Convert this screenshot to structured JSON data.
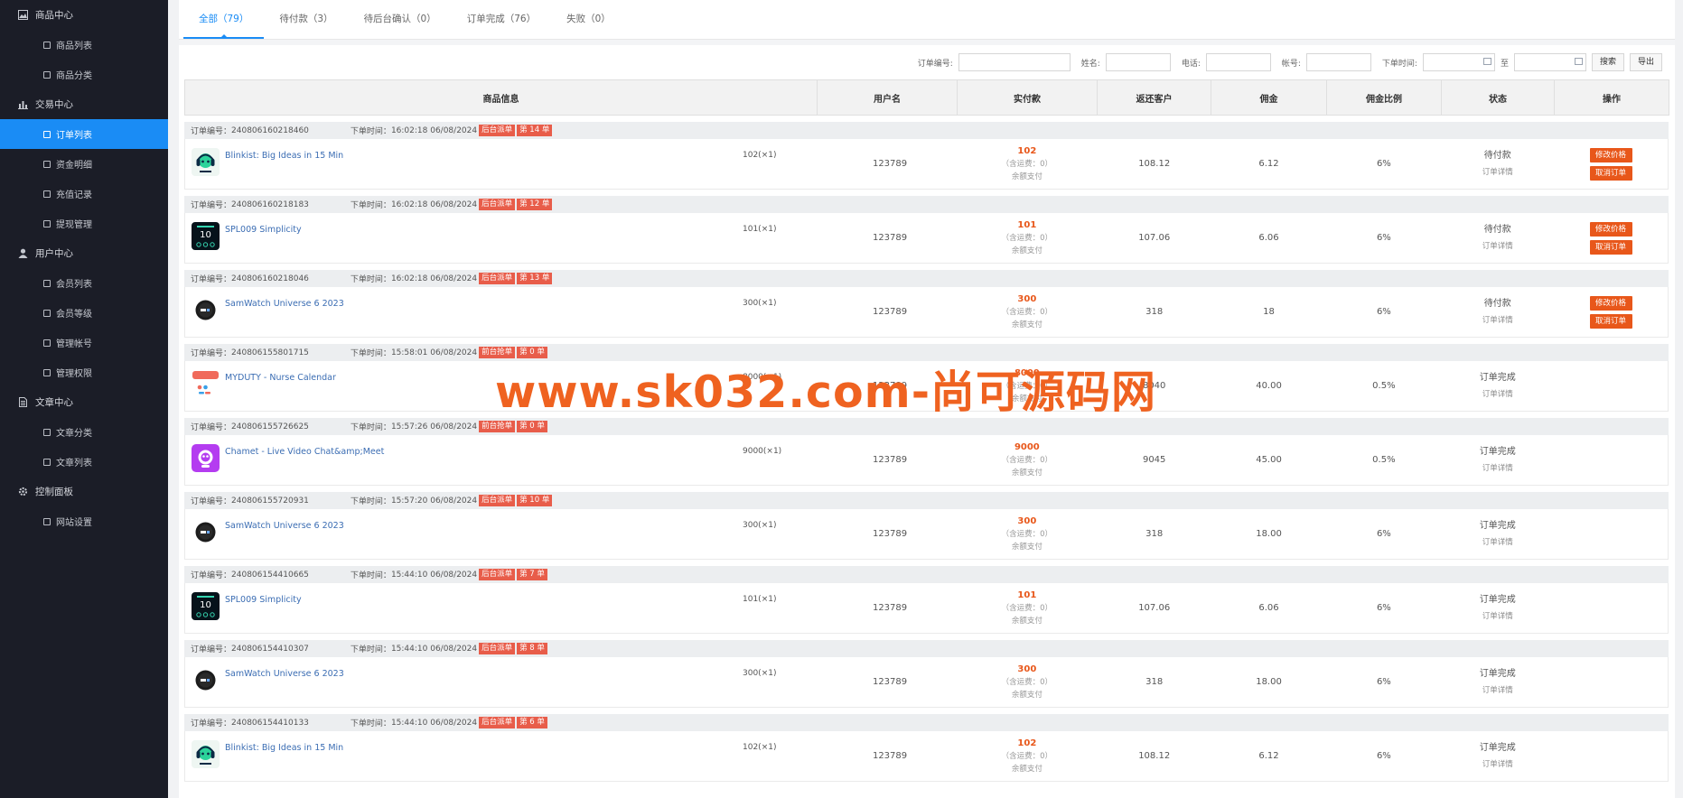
{
  "sidebar": {
    "groups": [
      {
        "label": "商品中心",
        "icon": "image-icon",
        "items": [
          {
            "label": "商品列表"
          },
          {
            "label": "商品分类"
          }
        ]
      },
      {
        "label": "交易中心",
        "icon": "chart-icon",
        "items": [
          {
            "label": "订单列表",
            "active": true
          },
          {
            "label": "资金明细"
          },
          {
            "label": "充值记录"
          },
          {
            "label": "提现管理"
          }
        ]
      },
      {
        "label": "用户中心",
        "icon": "user-icon",
        "items": [
          {
            "label": "会员列表"
          },
          {
            "label": "会员等级"
          },
          {
            "label": "管理帐号"
          },
          {
            "label": "管理权限"
          }
        ]
      },
      {
        "label": "文章中心",
        "icon": "document-icon",
        "items": [
          {
            "label": "文章分类"
          },
          {
            "label": "文章列表"
          }
        ]
      },
      {
        "label": "控制面板",
        "icon": "gear-icon",
        "items": [
          {
            "label": "网站设置"
          }
        ]
      }
    ]
  },
  "tabs": [
    {
      "label": "全部（79）",
      "active": true
    },
    {
      "label": "待付款（3）"
    },
    {
      "label": "待后台确认（0）"
    },
    {
      "label": "订单完成（76）"
    },
    {
      "label": "失败（0）"
    }
  ],
  "filter": {
    "order_no_label": "订单编号:",
    "name_label": "姓名:",
    "phone_label": "电话:",
    "account_label": "帐号:",
    "time_label": "下单时间:",
    "to_label": "至",
    "search_button": "搜索",
    "export_button": "导出"
  },
  "columns": [
    "商品信息",
    "用户名",
    "实付款",
    "返还客户",
    "佣金",
    "佣金比例",
    "状态",
    "操作"
  ],
  "labels": {
    "order_no": "订单编号：",
    "order_time": "下单时间：",
    "discount": "（含运费：0）",
    "pay_method": "余额支付",
    "order_detail": "订单详情",
    "edit_price": "修改价格",
    "cancel_order": "取消订单"
  },
  "orders": [
    {
      "no": "240806160218460",
      "time": "16:02:18 06/08/2024",
      "tag1": "后台派单",
      "tag2": "第 14 单",
      "product": "Blinkist: Big Ideas in 15 Min",
      "thumb": "blinkist",
      "qty": "102(×1)",
      "user": "123789",
      "paid": "102",
      "back": "108.12",
      "comm": "6.12",
      "rate": "6%",
      "status": "待付款",
      "pending": true
    },
    {
      "no": "240806160218183",
      "time": "16:02:18 06/08/2024",
      "tag1": "后台派单",
      "tag2": "第 12 单",
      "product": "SPL009 Simplicity",
      "thumb": "watch10",
      "qty": "101(×1)",
      "user": "123789",
      "paid": "101",
      "back": "107.06",
      "comm": "6.06",
      "rate": "6%",
      "status": "待付款",
      "pending": true
    },
    {
      "no": "240806160218046",
      "time": "16:02:18 06/08/2024",
      "tag1": "后台派单",
      "tag2": "第 13 单",
      "product": "SamWatch Universe 6 2023",
      "thumb": "samwatch",
      "qty": "300(×1)",
      "user": "123789",
      "paid": "300",
      "back": "318",
      "comm": "18",
      "rate": "6%",
      "status": "待付款",
      "pending": true
    },
    {
      "no": "240806155801715",
      "time": "15:58:01 06/08/2024",
      "tag1": "前台抢单",
      "tag2": "第 0 单",
      "product": "MYDUTY - Nurse Calendar",
      "thumb": "myduty",
      "qty": "8000(×1)",
      "user": "123789",
      "paid": "8000",
      "back": "8040",
      "comm": "40.00",
      "rate": "0.5%",
      "status": "订单完成",
      "pending": false
    },
    {
      "no": "240806155726625",
      "time": "15:57:26 06/08/2024",
      "tag1": "前台抢单",
      "tag2": "第 0 单",
      "product": "Chamet - Live Video Chat&amp;Meet",
      "thumb": "chamet",
      "qty": "9000(×1)",
      "user": "123789",
      "paid": "9000",
      "back": "9045",
      "comm": "45.00",
      "rate": "0.5%",
      "status": "订单完成",
      "pending": false
    },
    {
      "no": "240806155720931",
      "time": "15:57:20 06/08/2024",
      "tag1": "后台派单",
      "tag2": "第 10 单",
      "product": "SamWatch Universe 6 2023",
      "thumb": "samwatch",
      "qty": "300(×1)",
      "user": "123789",
      "paid": "300",
      "back": "318",
      "comm": "18.00",
      "rate": "6%",
      "status": "订单完成",
      "pending": false
    },
    {
      "no": "240806154410665",
      "time": "15:44:10 06/08/2024",
      "tag1": "后台派单",
      "tag2": "第 7 单",
      "product": "SPL009 Simplicity",
      "thumb": "watch10",
      "qty": "101(×1)",
      "user": "123789",
      "paid": "101",
      "back": "107.06",
      "comm": "6.06",
      "rate": "6%",
      "status": "订单完成",
      "pending": false
    },
    {
      "no": "240806154410307",
      "time": "15:44:10 06/08/2024",
      "tag1": "后台派单",
      "tag2": "第 8 单",
      "product": "SamWatch Universe 6 2023",
      "thumb": "samwatch",
      "qty": "300(×1)",
      "user": "123789",
      "paid": "300",
      "back": "318",
      "comm": "18.00",
      "rate": "6%",
      "status": "订单完成",
      "pending": false
    },
    {
      "no": "240806154410133",
      "time": "15:44:10 06/08/2024",
      "tag1": "后台派单",
      "tag2": "第 6 单",
      "product": "Blinkist: Big Ideas in 15 Min",
      "thumb": "blinkist",
      "qty": "102(×1)",
      "user": "123789",
      "paid": "102",
      "back": "108.12",
      "comm": "6.12",
      "rate": "6%",
      "status": "订单完成",
      "pending": false
    }
  ],
  "watermark": "www.sk032.com-尚可源码网"
}
